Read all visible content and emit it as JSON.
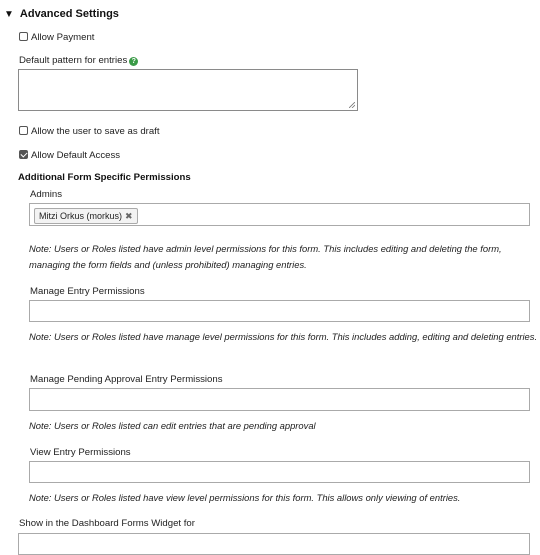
{
  "section": {
    "toggle_glyph": "▼",
    "title": "Advanced Settings"
  },
  "allow_payment": {
    "label": "Allow Payment",
    "checked": false
  },
  "default_pattern": {
    "label": "Default pattern for entries",
    "help_glyph": "?",
    "value": ""
  },
  "save_draft": {
    "label": "Allow the user to save as draft",
    "checked": false
  },
  "default_access": {
    "label": "Allow Default Access",
    "checked": true
  },
  "permissions": {
    "title": "Additional Form Specific Permissions",
    "admins": {
      "label": "Admins",
      "tag": "Mitzi Orkus (morkus)",
      "tag_remove": "✖",
      "note": "Note: Users or Roles listed have admin level permissions for this form. This includes editing and deleting the form, managing the form fields and (unless prohibited) managing entries."
    },
    "manage": {
      "label": "Manage Entry Permissions",
      "note": "Note: Users or Roles listed have manage level permissions for this form. This includes adding, editing and deleting entries."
    },
    "pending": {
      "label": "Manage Pending Approval Entry Permissions",
      "note": "Note: Users or Roles listed can edit entries that are pending approval"
    },
    "view": {
      "label": "View Entry Permissions",
      "note": "Note: Users or Roles listed have view level permissions for this form. This allows only viewing of entries."
    }
  },
  "dashboard": {
    "label": "Show in the Dashboard Forms Widget for"
  }
}
